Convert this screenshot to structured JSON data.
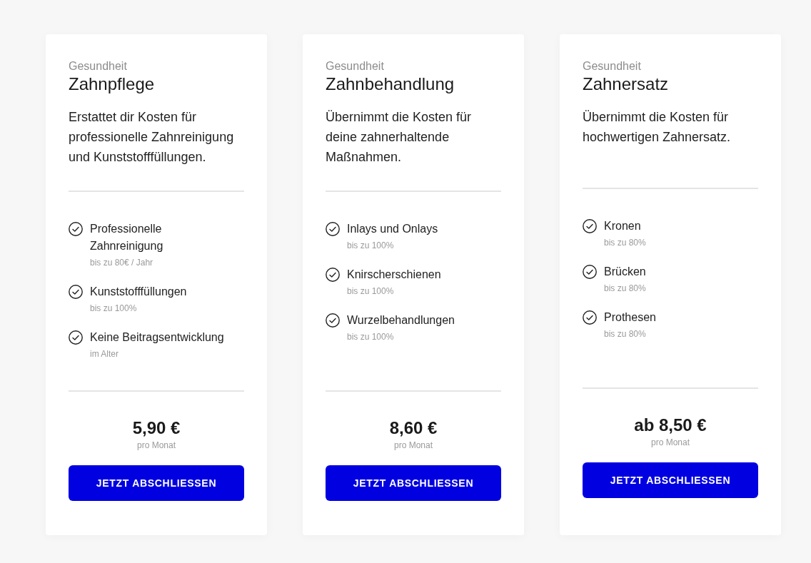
{
  "cards": [
    {
      "category": "Gesundheit",
      "title": "Zahnpflege",
      "description": "Erstattet dir Kosten für professionelle Zahnreinigung und Kunststofffüllungen.",
      "features": [
        {
          "label": "Professionelle Zahnreinigung",
          "note": "bis zu 80€ / Jahr"
        },
        {
          "label": "Kunststofffüllungen",
          "note": "bis zu 100%"
        },
        {
          "label": "Keine Beitragsentwicklung",
          "note": "im Alter"
        }
      ],
      "price": "5,90 €",
      "price_note": "pro Monat",
      "button": "JETZT ABSCHLIESSEN"
    },
    {
      "category": "Gesundheit",
      "title": "Zahnbehandlung",
      "description": "Übernimmt die Kosten für deine zahnerhaltende Maßnahmen.",
      "features": [
        {
          "label": "Inlays und Onlays",
          "note": "bis zu 100%"
        },
        {
          "label": "Knirscherschienen",
          "note": "bis zu 100%"
        },
        {
          "label": "Wurzelbehandlungen",
          "note": "bis zu 100%"
        }
      ],
      "price": "8,60 €",
      "price_note": "pro Monat",
      "button": "JETZT ABSCHLIESSEN"
    },
    {
      "category": "Gesundheit",
      "title": "Zahnersatz",
      "description": "Übernimmt die Kosten für hochwertigen Zahnersatz.",
      "features": [
        {
          "label": "Kronen",
          "note": "bis zu 80%"
        },
        {
          "label": "Brücken",
          "note": "bis zu 80%"
        },
        {
          "label": "Prothesen",
          "note": "bis zu 80%"
        }
      ],
      "price": "ab 8,50 €",
      "price_note": "pro Monat",
      "button": "JETZT ABSCHLIESSEN"
    }
  ]
}
